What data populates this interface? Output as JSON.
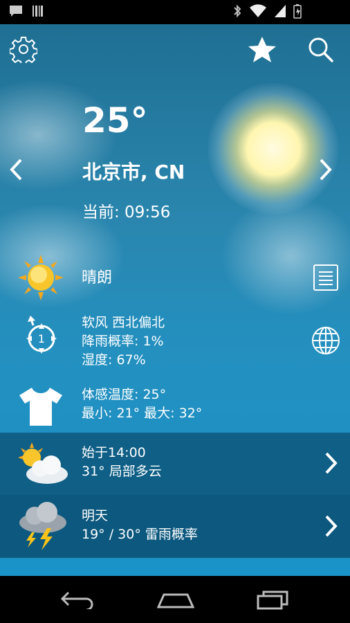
{
  "status_bar": {
    "time": "",
    "icons": [
      "chat-notification-icon",
      "barcode-icon",
      "bluetooth-icon",
      "wifi-icon",
      "signal-icon",
      "battery-icon"
    ]
  },
  "toolbar": {
    "settings_icon": "gear-icon",
    "favorite_icon": "star-icon",
    "search_icon": "search-icon"
  },
  "current": {
    "temperature": "25°",
    "city": "北京市, CN",
    "updated": "当前: 09:56",
    "condition": "晴朗",
    "wind": "软风 西北偏北",
    "precip": "降雨概率: 1%",
    "humidity": "湿度: 67%",
    "feels_like": "体感温度: 25°",
    "min_max": "最小: 21° 最大: 32°",
    "wind_speed": "1"
  },
  "forecast": [
    {
      "title": "始于14:00",
      "detail": "31° 局部多云",
      "icon": "partly-cloudy-icon"
    },
    {
      "title": "明天",
      "detail": "19° / 30° 雷雨概率",
      "icon": "thunderstorm-icon"
    }
  ],
  "colors": {
    "band_dark": "#0f5f86",
    "band_darker": "#0c587e",
    "band_light": "#1a93c9",
    "text": "#ffffff"
  }
}
